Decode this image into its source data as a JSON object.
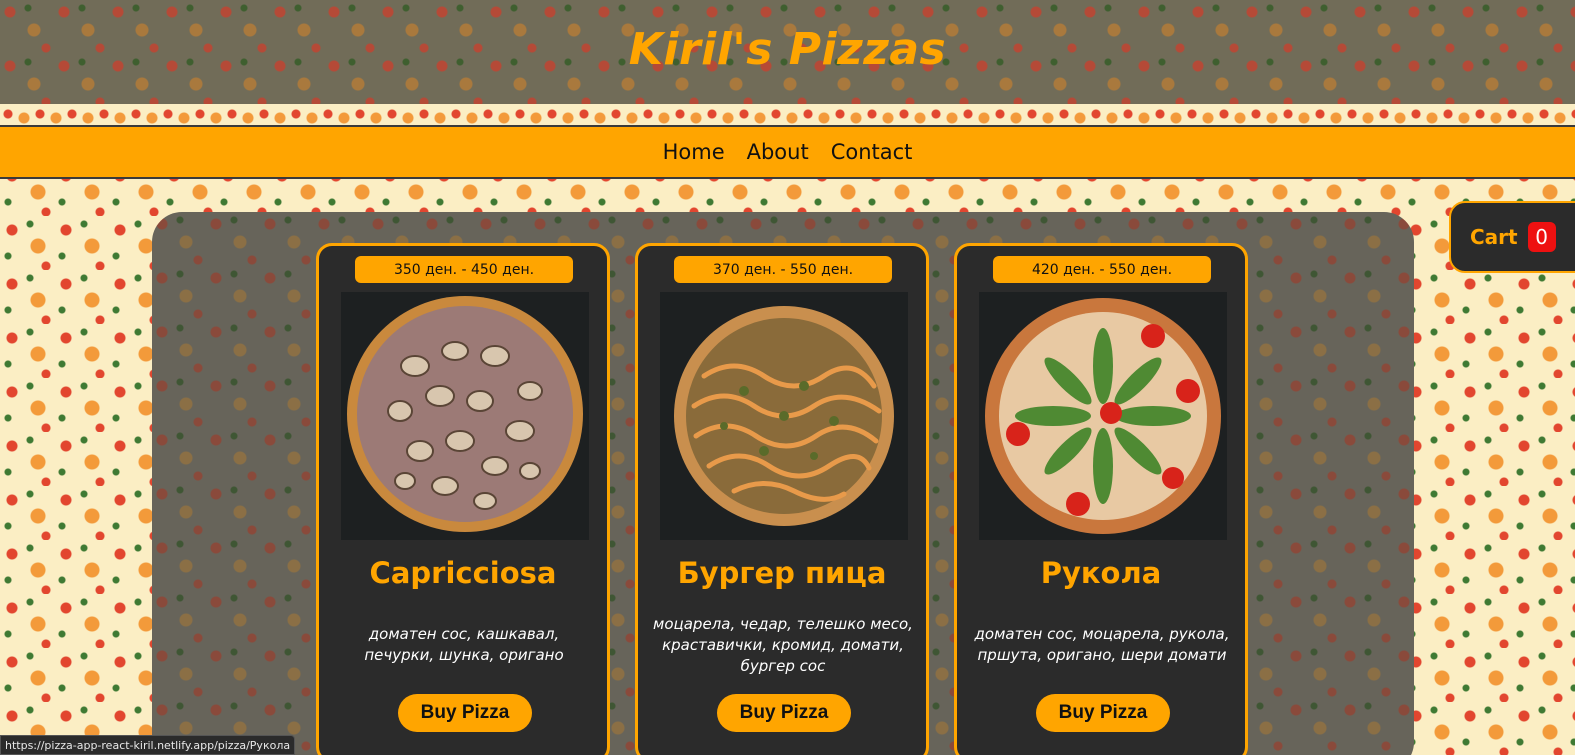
{
  "header": {
    "title": "Kiril's Pizzas"
  },
  "nav": {
    "items": [
      {
        "label": "Home"
      },
      {
        "label": "About"
      },
      {
        "label": "Contact"
      }
    ]
  },
  "cart": {
    "label": "Cart",
    "count": "0"
  },
  "pizzas": [
    {
      "price": "350 ден. - 450 ден.",
      "name": "Capricciosa",
      "description": "доматен сос, кашкавал, печурки, шунка, оригано",
      "buy_label": "Buy Pizza",
      "image_icon": "capricciosa-pizza-image"
    },
    {
      "price": "370 ден. - 550 ден.",
      "name": "Бургер пица",
      "description": "моцарела, чедар, телешко месо, краставички, кромид, домати, бургер сос",
      "buy_label": "Buy Pizza",
      "image_icon": "burger-pizza-image"
    },
    {
      "price": "420 ден. - 550 ден.",
      "name": "Рукола",
      "description": "доматен сос, моцарела, рукола, пршута, оригано, шери домати",
      "buy_label": "Buy Pizza",
      "image_icon": "rukola-pizza-image"
    }
  ],
  "status_bar": {
    "url": "https://pizza-app-react-kiril.netlify.app/pizza/Рукола"
  },
  "colors": {
    "accent": "#ffa500",
    "card_bg": "#2b2b2b",
    "badge": "#ee1111"
  }
}
